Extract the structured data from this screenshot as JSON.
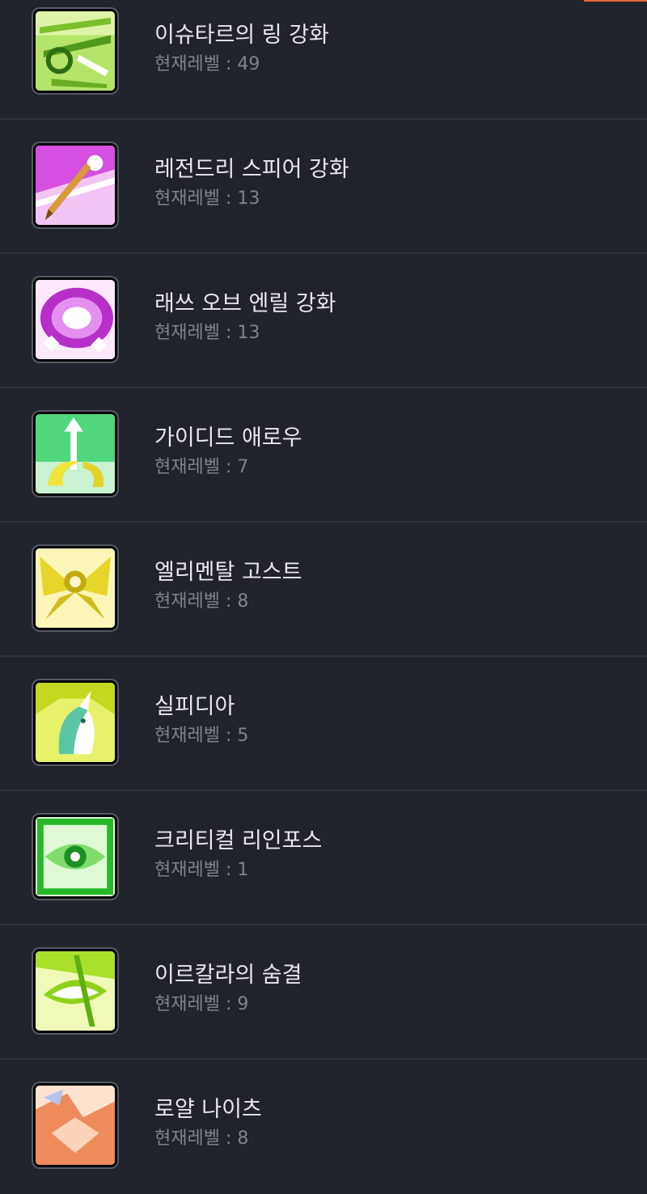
{
  "level_prefix": "현재레벨 : ",
  "colors": {
    "background": "#20232b",
    "divider": "#2e323b",
    "title_text": "#e7e8ec",
    "level_text": "#7e838d",
    "accent": "#e2683a"
  },
  "skills": [
    {
      "name": "이슈타르의 링 강화",
      "level_text": "현재레벨 : 49",
      "level": 49,
      "icon": "ring-arrow-icon",
      "icon_color": "#7dcf2e"
    },
    {
      "name": "레전드리 스피어 강화",
      "level_text": "현재레벨 : 13",
      "level": 13,
      "icon": "spear-icon",
      "icon_color": "#c63bd6"
    },
    {
      "name": "래쓰 오브 엔릴 강화",
      "level_text": "현재레벨 : 13",
      "level": 13,
      "icon": "wrath-burst-icon",
      "icon_color": "#b735c9"
    },
    {
      "name": "가이디드 애로우",
      "level_text": "현재레벨 : 7",
      "level": 7,
      "icon": "guided-arrow-icon",
      "icon_color": "#3ccf5f"
    },
    {
      "name": "엘리멘탈 고스트",
      "level_text": "현재레벨 : 8",
      "level": 8,
      "icon": "winged-ghost-icon",
      "icon_color": "#e8d52a"
    },
    {
      "name": "실피디아",
      "level_text": "현재레벨 : 5",
      "level": 5,
      "icon": "unicorn-icon",
      "icon_color": "#b8d820"
    },
    {
      "name": "크리티컬 리인포스",
      "level_text": "현재레벨 : 1",
      "level": 1,
      "icon": "eye-crest-icon",
      "icon_color": "#27b82a"
    },
    {
      "name": "이르칼라의 숨결",
      "level_text": "현재레벨 : 9",
      "level": 9,
      "icon": "leaf-breath-icon",
      "icon_color": "#9bd61e"
    },
    {
      "name": "로얄 나이츠",
      "level_text": "현재레벨 : 8",
      "level": 8,
      "icon": "royal-knights-icon",
      "icon_color": "#ef8a5a"
    }
  ]
}
